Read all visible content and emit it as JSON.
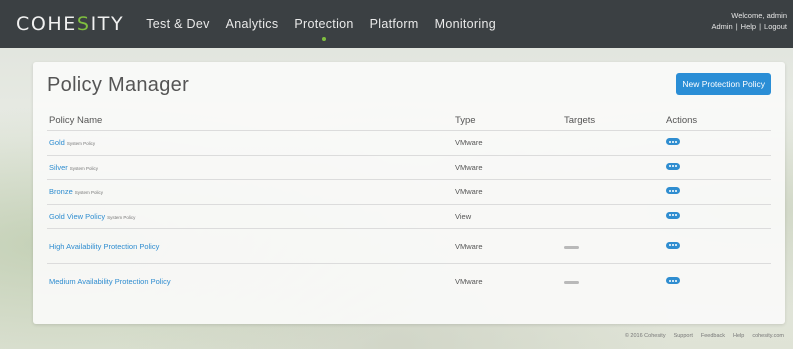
{
  "app": {
    "logo_pre": "COHE",
    "logo_accent": "S",
    "logo_post": "ITY",
    "nav": [
      "Test & Dev",
      "Analytics",
      "Protection",
      "Platform",
      "Monitoring"
    ],
    "active_nav": "Protection",
    "welcome_text": "Welcome, admin",
    "user_links": [
      "Admin",
      "Help",
      "Logout"
    ]
  },
  "page": {
    "title": "Policy Manager",
    "new_button_label": "New Protection Policy"
  },
  "table": {
    "headers": {
      "name": "Policy Name",
      "type": "Type",
      "targets": "Targets",
      "actions": "Actions"
    },
    "rows": [
      {
        "name": "Gold",
        "tag": "System Policy",
        "type": "VMware",
        "has_target": false
      },
      {
        "name": "Silver",
        "tag": "System Policy",
        "type": "VMware",
        "has_target": false
      },
      {
        "name": "Bronze",
        "tag": "System Policy",
        "type": "VMware",
        "has_target": false
      },
      {
        "name": "Gold View Policy",
        "tag": "System Policy",
        "type": "View",
        "has_target": false
      },
      {
        "name": "High Availability Protection Policy",
        "tag": "",
        "type": "VMware",
        "has_target": true
      },
      {
        "name": "Medium Availability Protection Policy",
        "tag": "",
        "type": "VMware",
        "has_target": true
      }
    ]
  },
  "footer": {
    "copyright": "© 2016 Cohesity",
    "links": [
      "Support",
      "Feedback",
      "Help",
      "cohesity.com"
    ]
  },
  "icons": {
    "actions": "ellipsis-icon",
    "target": "target-indicator-icon"
  },
  "colors": {
    "nav_bg": "#3b4043",
    "accent_green": "#7fbf3f",
    "link_blue": "#2f8dd0",
    "button_blue": "#2a8ed6"
  }
}
